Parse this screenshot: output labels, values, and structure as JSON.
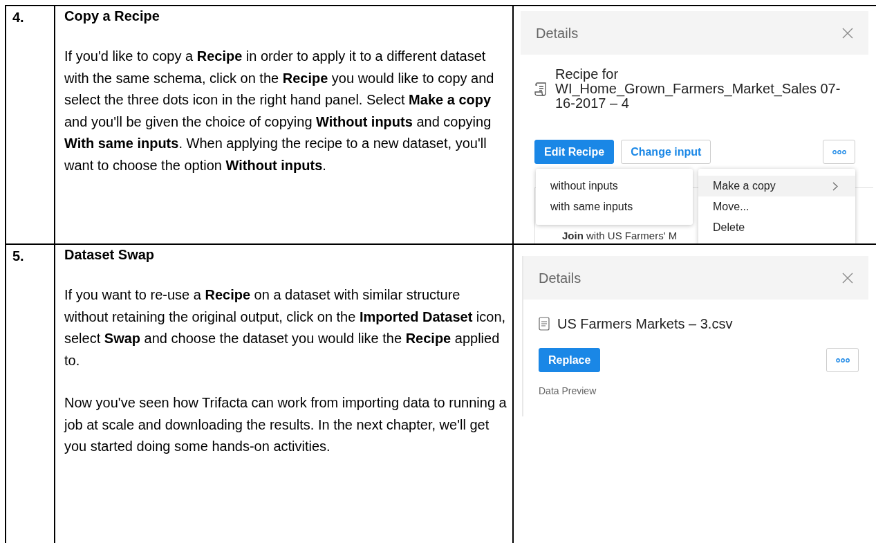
{
  "steps": [
    {
      "number": "4.",
      "title": "Copy a Recipe",
      "paragraphs": [
        "If you'd like to copy a **Recipe** in order to apply it to a different dataset with the same schema, click on the **Recipe** you would like to copy and select the three dots icon in the right hand panel. Select **Make a copy** and you'll be given the choice of copying **Without inputs** and copying **With same inputs**. When applying the recipe to a new dataset, you'll want to choose the option **Without inputs**."
      ],
      "panel": {
        "kind": "recipe",
        "header": "Details",
        "name": "Recipe for WI_Home_Grown_Farmers_Market_Sales 07-16-2017 – 4",
        "buttons": [
          {
            "label": "Edit Recipe",
            "kind": "primary"
          },
          {
            "label": "Change input",
            "kind": "secondary"
          }
        ],
        "background_step": "**Join** with US Farmers' M",
        "submenu": [
          "without inputs",
          "with same inputs"
        ],
        "menu": [
          {
            "label": "Make a copy",
            "selected": true,
            "has_submenu": true
          },
          {
            "label": "Move...",
            "selected": false,
            "has_submenu": false
          },
          {
            "label": "Delete",
            "selected": false,
            "has_submenu": false
          }
        ]
      }
    },
    {
      "number": "5.",
      "title": "Dataset Swap",
      "paragraphs": [
        "If you want to re-use a **Recipe** on a dataset with similar structure without retaining the original output, click on the **Imported Dataset** icon, select **Swap** and choose the dataset you would like the **Recipe** applied to.",
        "Now you've seen how Trifacta can work from importing data to running a job at scale and downloading the results. In the next chapter, we'll get you started doing some hands-on activities."
      ],
      "panel": {
        "kind": "dataset",
        "header": "Details",
        "name": "US Farmers Markets – 3.csv",
        "buttons": [
          {
            "label": "Replace",
            "kind": "primary"
          }
        ],
        "section": "Data Preview"
      }
    }
  ]
}
